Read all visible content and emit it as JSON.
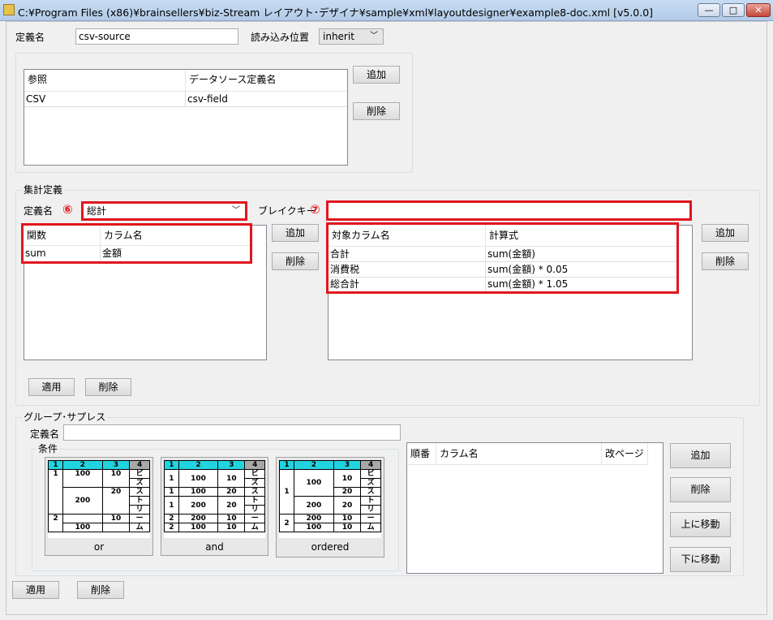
{
  "window": {
    "title": "C:¥Program Files (x86)¥brainsellers¥biz-Stream レイアウト･デザイナ¥sample¥xml¥layoutdesigner¥example8-doc.xml [v5.0.0]",
    "controls": {
      "minimize": "—",
      "maximize": "□",
      "close": "✕"
    }
  },
  "definition": {
    "name_label": "定義名",
    "name_value": "csv-source",
    "load_pos_label": "読み込み位置",
    "load_pos_value": "inherit"
  },
  "reference_grid": {
    "headers": [
      "参照",
      "データソース定義名"
    ],
    "rows": [
      [
        "CSV",
        "csv-field"
      ]
    ],
    "add_label": "追加",
    "delete_label": "削除"
  },
  "aggregate": {
    "group_label": "集計定義",
    "name_label": "定義名",
    "marker6": "⑥",
    "name_value": "総計",
    "break_key_label": "ブレイクキー",
    "marker7": "⑦",
    "break_key_value": "",
    "func_grid": {
      "headers": [
        "関数",
        "カラム名"
      ],
      "rows": [
        [
          "sum",
          "金額"
        ]
      ]
    },
    "func_add": "追加",
    "func_delete": "削除",
    "target_grid": {
      "headers": [
        "対象カラム名",
        "計算式"
      ],
      "rows": [
        [
          "合計",
          "sum(金額)"
        ],
        [
          "消費税",
          "sum(金額) * 0.05"
        ],
        [
          "総合計",
          "sum(金額) * 1.05"
        ]
      ]
    },
    "target_add": "追加",
    "target_delete": "削除",
    "apply_label": "適用",
    "delete_label": "削除"
  },
  "group_suppress": {
    "group_label": "グループ･サプレス",
    "name_label": "定義名",
    "name_value": "",
    "condition_label": "条件",
    "conditions": [
      {
        "label": "or",
        "head": [
          "1",
          "2",
          "3",
          "4"
        ],
        "c1": [
          "1",
          "2"
        ],
        "c2": [
          "100",
          "200",
          "100"
        ],
        "c3": [
          "10",
          "20",
          "10"
        ],
        "c4": [
          "ビ",
          "ズ",
          "ス",
          "ト",
          "リ",
          "ー",
          "ム"
        ]
      },
      {
        "label": "and",
        "head": [
          "1",
          "2",
          "3",
          "4"
        ],
        "c1": [
          "1",
          "1",
          "1",
          "1",
          "2",
          "2"
        ],
        "c2": [
          "100",
          "100",
          "200",
          "200",
          "200",
          "100"
        ],
        "c3": [
          "10",
          "20",
          "20",
          "10",
          "10"
        ],
        "c4": [
          "ビ",
          "ズ",
          "ス",
          "ト",
          "リ",
          "ー",
          "ム"
        ]
      },
      {
        "label": "ordered",
        "head": [
          "1",
          "2",
          "3",
          "4"
        ],
        "c1": [
          "1",
          "2"
        ],
        "c2": [
          "100",
          "200",
          "200",
          "100"
        ],
        "c3": [
          "10",
          "20",
          "20",
          "10",
          "10"
        ],
        "c4": [
          "ビ",
          "ズ",
          "ス",
          "ト",
          "リ",
          "ー",
          "ム"
        ]
      }
    ],
    "order_grid": {
      "headers": [
        "順番",
        "カラム名",
        "改ページ"
      ]
    },
    "add_label": "追加",
    "delete_label": "削除",
    "move_up_label": "上に移動",
    "move_down_label": "下に移動"
  },
  "footer": {
    "apply_label": "適用",
    "delete_label": "削除"
  }
}
